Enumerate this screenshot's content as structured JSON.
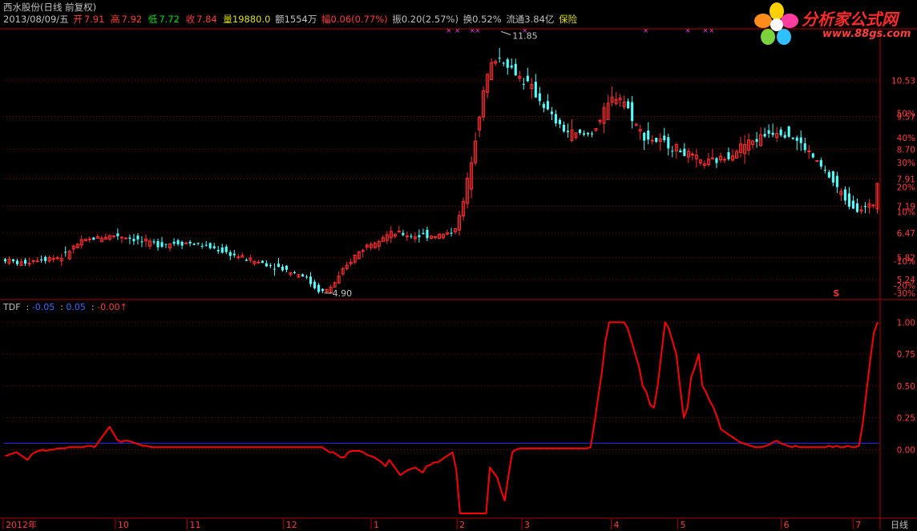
{
  "header": {
    "title": "西水股份(日线 前复权)",
    "date": "2013/08/09/五",
    "open_label": "开",
    "open": "7.91",
    "high_label": "高",
    "high": "7.92",
    "low_label": "低",
    "low": "7.72",
    "close_label": "收",
    "close": "7.84",
    "volume": "量19880.0",
    "amount": "额1554万",
    "change": "幅0.06(0.77%)",
    "amplitude": "振0.20(2.57%)",
    "turnover": "换0.52%",
    "float_cap": "流通3.84亿",
    "sector": "保险"
  },
  "logo": {
    "text": "分析家公式网",
    "url": "www.88gs.com"
  },
  "indicator": {
    "name": "TDF",
    "v1": "-0.05",
    "v2": "0.05",
    "v3": "-0.00"
  },
  "period_label": "日线",
  "colors": {
    "up": "#ff3030",
    "down": "#54ffff",
    "grid": "#8b0000",
    "axis": "#b00000",
    "text_up": "#ff3c3c",
    "text_down": "#00e000",
    "indicator_line": "#ff0000",
    "ref_line": "#2020ff",
    "magenta": "#e040e0"
  },
  "chart_data": [
    {
      "type": "candlestick",
      "title": "西水股份(日线 前复权)",
      "price_axis_labels": [
        "10.53",
        "9.57",
        "8.70",
        "7.91",
        "7.19",
        "6.47",
        "5.82",
        "5.24"
      ],
      "price_axis_values": [
        10.53,
        9.57,
        8.7,
        7.91,
        7.19,
        6.47,
        5.82,
        5.24
      ],
      "percent_axis_labels": [
        "50%",
        "40%",
        "30%",
        "20%",
        "10%",
        "-10%",
        "-20%",
        "-30%"
      ],
      "percent_axis_values": [
        50,
        40,
        30,
        20,
        10,
        -10,
        -20,
        -30
      ],
      "x_labels": [
        "2012年",
        "10",
        "11",
        "12",
        "1",
        "2",
        "3",
        "4",
        "5",
        "6",
        "7"
      ],
      "ylim": [
        4.75,
        11.9
      ],
      "annotations": [
        {
          "text": "11.85",
          "kind": "high",
          "value": 11.85
        },
        {
          "text": "4.90",
          "kind": "low",
          "value": 4.9
        },
        {
          "text": "S",
          "kind": "signal"
        }
      ],
      "series": [
        {
          "name": "close",
          "values": [
            5.77,
            5.73,
            5.71,
            5.68,
            5.67,
            5.7,
            5.72,
            5.76,
            5.78,
            5.8,
            5.79,
            5.83,
            5.81,
            5.83,
            5.84,
            5.9,
            6.01,
            6.1,
            6.17,
            6.22,
            6.27,
            6.3,
            6.33,
            6.35,
            6.37,
            6.39,
            6.4,
            6.41,
            6.41,
            6.39,
            6.37,
            6.34,
            6.31,
            6.28,
            6.25,
            6.22,
            6.2,
            6.19,
            6.18,
            6.18,
            6.19,
            6.2,
            6.21,
            6.22,
            6.22,
            6.21,
            6.2,
            6.18,
            6.16,
            6.14,
            6.11,
            6.09,
            6.06,
            6.03,
            5.99,
            5.95,
            5.92,
            5.88,
            5.85,
            5.81,
            5.78,
            5.76,
            5.73,
            5.7,
            5.68,
            5.65,
            5.62,
            5.59,
            5.56,
            5.53,
            5.49,
            5.46,
            5.42,
            5.4,
            5.35,
            5.27,
            5.14,
            5.03,
            4.95,
            4.92,
            4.96,
            5.04,
            5.16,
            5.3,
            5.45,
            5.6,
            5.74,
            5.87,
            5.97,
            6.06,
            6.14,
            6.22,
            6.29,
            6.35,
            6.39,
            6.42,
            6.44,
            6.45,
            6.45,
            6.44,
            6.42,
            6.41,
            6.4,
            6.4,
            6.41,
            6.41,
            6.41,
            6.41,
            6.42,
            6.43,
            6.45,
            6.51,
            6.64,
            6.89,
            7.3,
            7.85,
            8.45,
            9.05,
            9.65,
            10.2,
            10.65,
            10.95,
            11.1,
            11.12,
            11.06,
            10.96,
            10.84,
            10.73,
            10.62,
            10.52,
            10.42,
            10.3,
            10.16,
            10.01,
            9.86,
            9.7,
            9.55,
            9.42,
            9.31,
            9.22,
            9.16,
            9.12,
            9.1,
            9.09,
            9.08,
            9.1,
            9.17,
            9.31,
            9.48,
            9.68,
            9.86,
            10.02,
            10.11,
            10.1,
            9.98,
            9.77,
            9.55,
            9.34,
            9.17,
            9.05,
            8.99,
            8.95,
            8.92,
            8.89,
            8.86,
            8.82,
            8.77,
            8.72,
            8.66,
            8.6,
            8.54,
            8.48,
            8.42,
            8.37,
            8.35,
            8.35,
            8.37,
            8.4,
            8.44,
            8.49,
            8.55,
            8.62,
            8.7,
            8.77,
            8.83,
            8.88,
            8.92,
            8.96,
            9.02,
            9.08,
            9.14,
            9.18,
            9.19,
            9.18,
            9.14,
            9.08,
            9.0,
            8.92,
            8.82,
            8.72,
            8.6,
            8.48,
            8.35,
            8.22,
            8.1,
            7.96,
            7.82,
            7.67,
            7.52,
            7.38,
            7.26,
            7.18,
            7.13,
            7.12,
            7.14,
            7.18,
            7.25,
            7.84
          ]
        }
      ]
    },
    {
      "type": "line",
      "title": "TDF",
      "y_tick_labels": [
        "1.00",
        "0.75",
        "0.50",
        "0.25",
        "0.00"
      ],
      "y_tick_values": [
        1.0,
        0.75,
        0.5,
        0.25,
        0.0
      ],
      "ylim": [
        -0.5,
        1.04
      ],
      "reference_line": 0.05,
      "series": [
        {
          "name": "TDF",
          "values": [
            -0.05,
            -0.04,
            -0.03,
            -0.02,
            -0.04,
            -0.06,
            -0.08,
            -0.04,
            -0.02,
            -0.01,
            -0.0,
            -0.01,
            -0.0,
            0.0,
            0.01,
            0.01,
            0.01,
            0.02,
            0.02,
            0.02,
            0.02,
            0.02,
            0.03,
            0.03,
            0.02,
            0.06,
            0.1,
            0.14,
            0.18,
            0.13,
            0.08,
            0.06,
            0.07,
            0.07,
            0.06,
            0.05,
            0.04,
            0.03,
            0.03,
            0.02,
            0.02,
            0.02,
            0.02,
            0.02,
            0.02,
            0.02,
            0.02,
            0.02,
            0.02,
            0.02,
            0.02,
            0.02,
            0.02,
            0.02,
            0.02,
            0.02,
            0.02,
            0.02,
            0.02,
            0.02,
            0.02,
            0.02,
            0.02,
            0.02,
            0.02,
            0.02,
            0.02,
            0.02,
            0.02,
            0.02,
            0.02,
            0.02,
            0.02,
            0.02,
            0.02,
            0.02,
            0.02,
            0.02,
            0.02,
            0.02,
            0.02,
            0.02,
            0.02,
            0.02,
            0.02,
            0.02,
            0.0,
            -0.02,
            -0.02,
            -0.04,
            -0.06,
            -0.06,
            -0.02,
            -0.01,
            -0.01,
            -0.01,
            -0.02,
            -0.04,
            -0.05,
            -0.06,
            -0.08,
            -0.1,
            -0.13,
            -0.08,
            -0.12,
            -0.16,
            -0.2,
            -0.18,
            -0.16,
            -0.15,
            -0.14,
            -0.16,
            -0.18,
            -0.13,
            -0.12,
            -0.1,
            -0.1,
            -0.08,
            -0.06,
            -0.04,
            -0.02,
            -0.16,
            -0.5,
            -0.5,
            -0.5,
            -0.5,
            -0.5,
            -0.5,
            -0.5,
            -0.5,
            -0.14,
            -0.18,
            -0.22,
            -0.32,
            -0.4,
            -0.2,
            -0.02,
            0.0,
            0.01,
            0.01,
            0.01,
            0.01,
            0.01,
            0.01,
            0.01,
            0.01,
            0.01,
            0.01,
            0.01,
            0.01,
            0.01,
            0.01,
            0.01,
            0.01,
            0.01,
            0.01,
            0.01,
            0.02,
            0.2,
            0.4,
            0.6,
            0.85,
            1.0,
            1.0,
            1.0,
            1.0,
            1.0,
            0.95,
            0.85,
            0.75,
            0.65,
            0.5,
            0.45,
            0.35,
            0.33,
            0.5,
            0.75,
            1.0,
            0.95,
            0.85,
            0.75,
            0.5,
            0.25,
            0.33,
            0.57,
            0.65,
            0.75,
            0.5,
            0.45,
            0.38,
            0.33,
            0.25,
            0.16,
            0.14,
            0.12,
            0.1,
            0.08,
            0.06,
            0.05,
            0.04,
            0.03,
            0.02,
            0.02,
            0.02,
            0.03,
            0.04,
            0.06,
            0.07,
            0.05,
            0.04,
            0.03,
            0.02,
            0.03,
            0.02,
            0.02,
            0.02,
            0.02,
            0.02,
            0.02,
            0.02,
            0.02,
            0.03,
            0.02,
            0.03,
            0.02,
            0.02,
            0.03,
            0.02,
            0.02,
            0.03,
            0.2,
            0.45,
            0.7,
            0.92,
            1.0
          ]
        }
      ]
    }
  ]
}
